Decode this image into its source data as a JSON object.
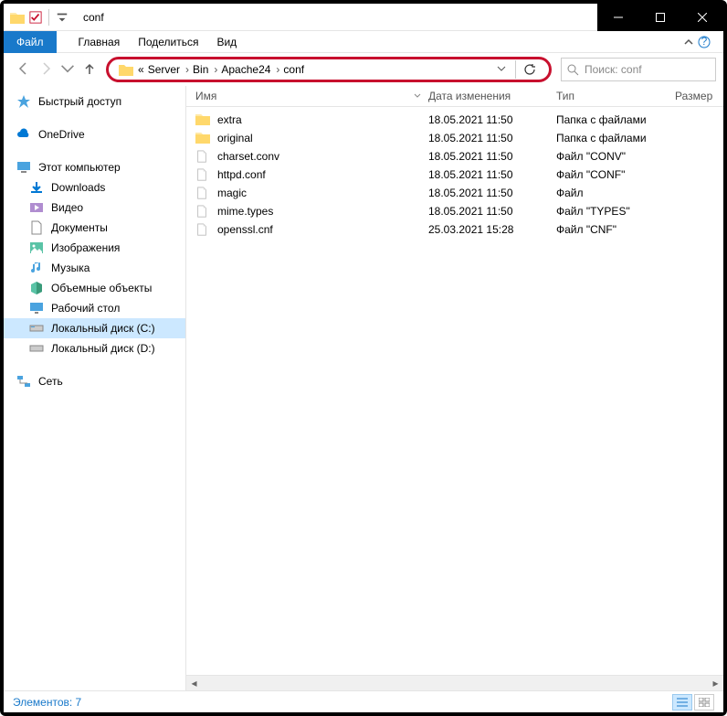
{
  "title": "conf",
  "menubar": {
    "file": "Файл",
    "home": "Главная",
    "share": "Поделиться",
    "view": "Вид"
  },
  "breadcrumb": {
    "prefix": "«",
    "items": [
      "Server",
      "Bin",
      "Apache24",
      "conf"
    ]
  },
  "search": {
    "placeholder": "Поиск: conf"
  },
  "sidebar": {
    "quick": {
      "label": "Быстрый доступ"
    },
    "onedrive": {
      "label": "OneDrive"
    },
    "thispc": {
      "label": "Этот компьютер",
      "children": [
        {
          "label": "Downloads"
        },
        {
          "label": "Видео"
        },
        {
          "label": "Документы"
        },
        {
          "label": "Изображения"
        },
        {
          "label": "Музыка"
        },
        {
          "label": "Объемные объекты"
        },
        {
          "label": "Рабочий стол"
        },
        {
          "label": "Локальный диск (C:)"
        },
        {
          "label": "Локальный диск (D:)"
        }
      ]
    },
    "network": {
      "label": "Сеть"
    }
  },
  "columns": {
    "name": "Имя",
    "date": "Дата изменения",
    "type": "Тип",
    "size": "Размер"
  },
  "files": [
    {
      "name": "extra",
      "date": "18.05.2021 11:50",
      "type": "Папка с файлами",
      "kind": "folder"
    },
    {
      "name": "original",
      "date": "18.05.2021 11:50",
      "type": "Папка с файлами",
      "kind": "folder"
    },
    {
      "name": "charset.conv",
      "date": "18.05.2021 11:50",
      "type": "Файл \"CONV\"",
      "kind": "file"
    },
    {
      "name": "httpd.conf",
      "date": "18.05.2021 11:50",
      "type": "Файл \"CONF\"",
      "kind": "file"
    },
    {
      "name": "magic",
      "date": "18.05.2021 11:50",
      "type": "Файл",
      "kind": "file"
    },
    {
      "name": "mime.types",
      "date": "18.05.2021 11:50",
      "type": "Файл \"TYPES\"",
      "kind": "file"
    },
    {
      "name": "openssl.cnf",
      "date": "25.03.2021 15:28",
      "type": "Файл \"CNF\"",
      "kind": "file"
    }
  ],
  "status": {
    "count_label": "Элементов: 7"
  }
}
